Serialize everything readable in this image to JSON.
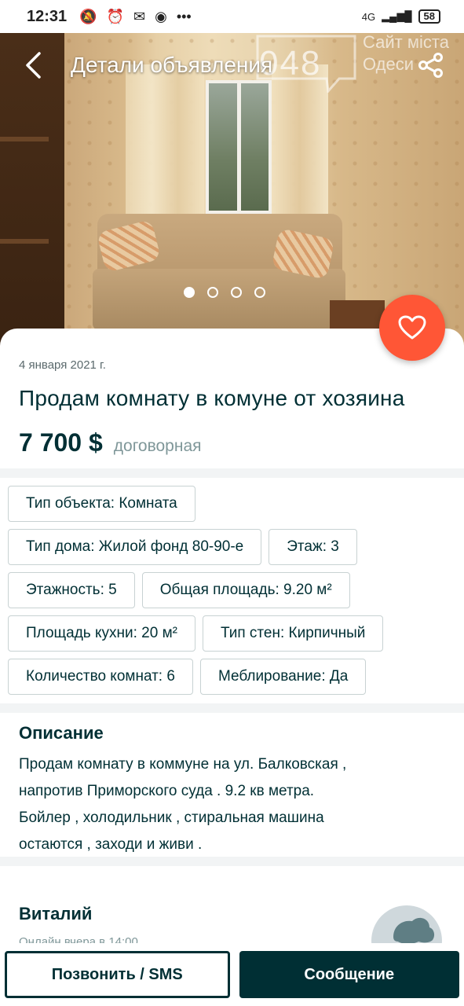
{
  "status_bar": {
    "time": "12:31",
    "network": "4G",
    "battery": "58"
  },
  "topbar": {
    "title": "Детали объявления"
  },
  "watermark": {
    "number": "048",
    "line1": "Сайт міста",
    "line2": "Одеси"
  },
  "gallery": {
    "total": 4,
    "active": 1
  },
  "ad": {
    "date": "4 января 2021 г.",
    "title": "Продам комнату в комуне от хозяина",
    "price": "7 700 $",
    "price_note": "договорная"
  },
  "params": [
    [
      "Тип объекта: Комната"
    ],
    [
      "Тип дома: Жилой фонд 80-90-е",
      "Этаж: 3"
    ],
    [
      "Этажность: 5",
      "Общая площадь: 9.20 м²"
    ],
    [
      "Площадь кухни: 20 м²",
      "Тип стен: Кирпичный"
    ],
    [
      "Количество комнат: 6",
      "Меблирование: Да"
    ]
  ],
  "description": {
    "title": "Описание",
    "lines": [
      "Продам комнату в коммуне на ул. Балковская ,",
      "напротив Приморского суда . 9.2 кв метра.",
      "Бойлер , холодильник , стиральная машина",
      "остаются , заходи и живи ."
    ]
  },
  "seller": {
    "name": "Виталий",
    "online": "Онлайн вчера в 14:00"
  },
  "actions": {
    "call_label": "Позвонить / SMS",
    "message_label": "Сообщение"
  },
  "colors": {
    "accent": "#ff5636",
    "primary": "#002f34",
    "divider": "#f2f4f5"
  }
}
